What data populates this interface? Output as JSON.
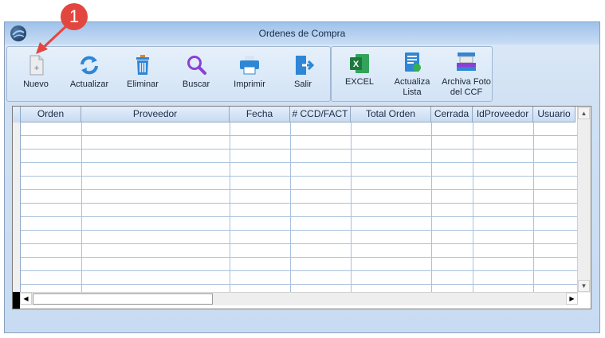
{
  "window": {
    "title": "Ordenes de Compra"
  },
  "annotation": {
    "step": "1"
  },
  "toolbar": {
    "main": [
      {
        "label": "Nuevo",
        "icon": "new-document-icon"
      },
      {
        "label": "Actualizar",
        "icon": "refresh-icon"
      },
      {
        "label": "Eliminar",
        "icon": "trash-icon"
      },
      {
        "label": "Buscar",
        "icon": "search-icon"
      },
      {
        "label": "Imprimir",
        "icon": "printer-icon"
      },
      {
        "label": "Salir",
        "icon": "exit-icon"
      }
    ],
    "extra": [
      {
        "label": "EXCEL",
        "icon": "excel-icon"
      },
      {
        "label": "Actualiza\nLista",
        "icon": "update-list-icon"
      },
      {
        "label": "Archiva Foto\ndel CCF",
        "icon": "scanner-icon"
      }
    ]
  },
  "table": {
    "columns": [
      "Orden",
      "Proveedor",
      "Fecha",
      "# CCD/FACT",
      "Total Orden",
      "Cerrada",
      "IdProveedor",
      "Usuario"
    ],
    "rows": []
  },
  "colors": {
    "accent": "#e2473f",
    "titlebar": "#9fc2ea",
    "grid_line": "#a9c0dc"
  }
}
